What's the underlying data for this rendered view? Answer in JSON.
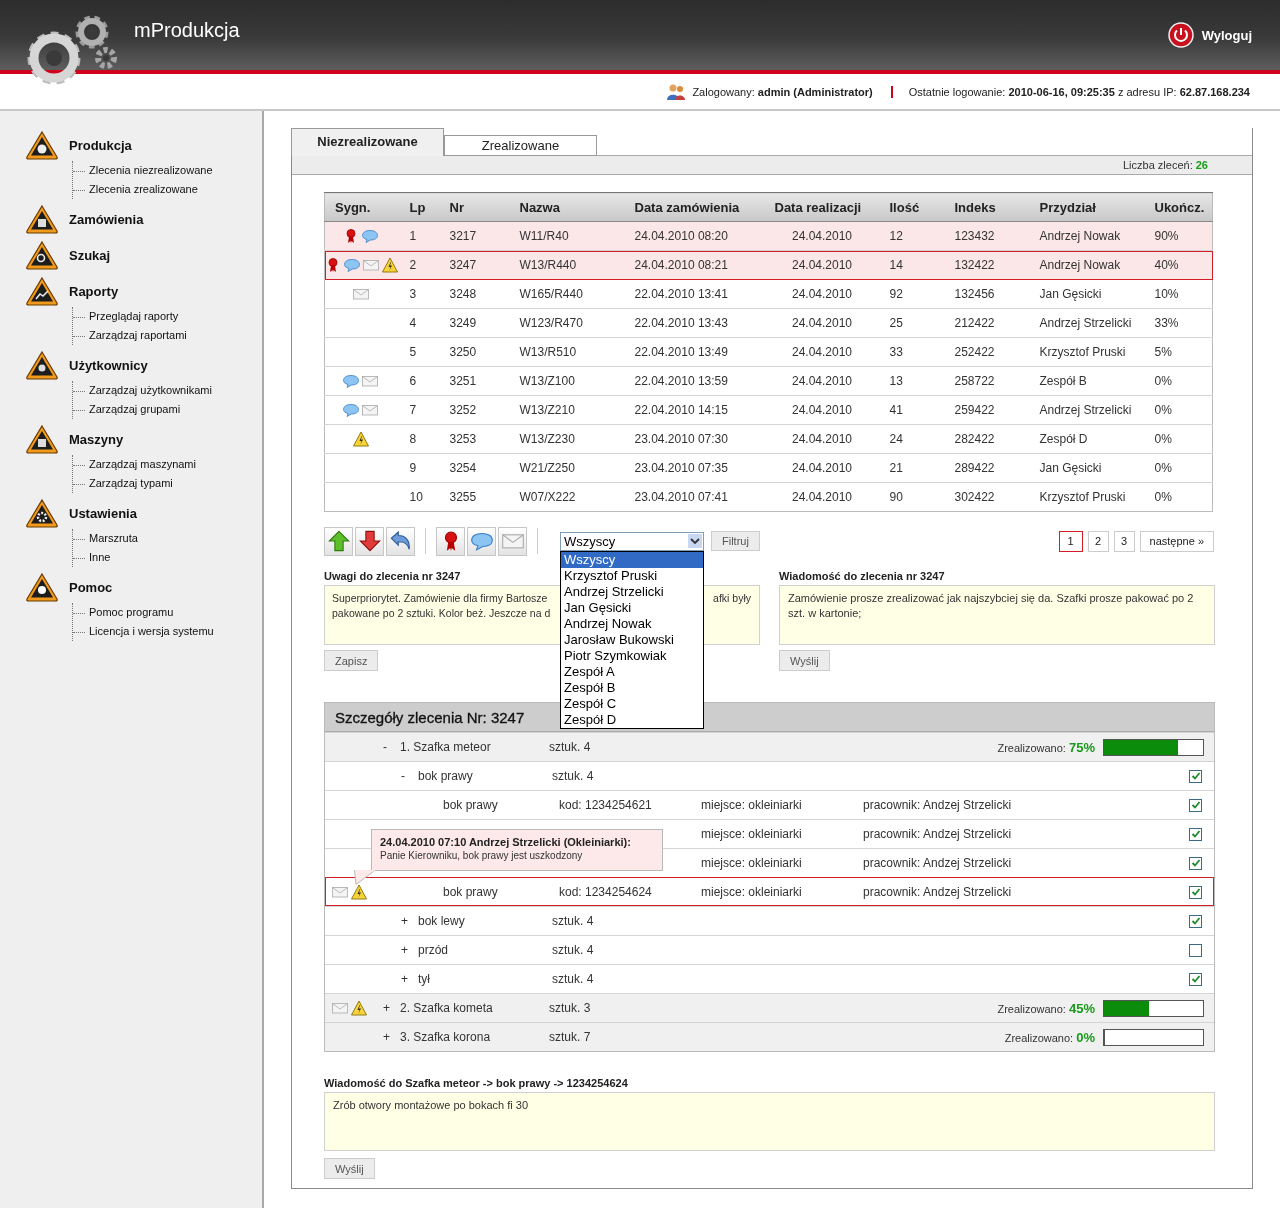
{
  "header": {
    "app_title": "mProdukcja",
    "logout": "Wyloguj"
  },
  "session": {
    "user_label": "Zalogowany:",
    "user": "admin (Administrator)",
    "last_login_label": "Ostatnie logowanie:",
    "last_login": "2010-06-16, 09:25:35",
    "ip_label": "z adresu IP:",
    "ip": "62.87.168.234"
  },
  "sidebar": {
    "items": [
      {
        "label": "Produkcja",
        "children": [
          {
            "label": "Zlecenia niezrealizowane"
          },
          {
            "label": "Zlecenia zrealizowane"
          }
        ]
      },
      {
        "label": "Zamówienia"
      },
      {
        "label": "Szukaj"
      },
      {
        "label": "Raporty",
        "children": [
          {
            "label": "Przeglądaj raporty"
          },
          {
            "label": "Zarządzaj raportami"
          }
        ]
      },
      {
        "label": "Użytkownicy",
        "children": [
          {
            "label": "Zarządzaj użytkownikami"
          },
          {
            "label": "Zarządzaj grupami"
          }
        ]
      },
      {
        "label": "Maszyny",
        "children": [
          {
            "label": "Zarządzaj maszynami"
          },
          {
            "label": "Zarządzaj typami"
          }
        ]
      },
      {
        "label": "Ustawienia",
        "children": [
          {
            "label": "Marszruta"
          },
          {
            "label": "Inne"
          }
        ]
      },
      {
        "label": "Pomoc",
        "children": [
          {
            "label": "Pomoc programu"
          },
          {
            "label": "Licencja i wersja systemu"
          }
        ]
      }
    ]
  },
  "tabs": [
    {
      "label": "Niezrealizowane",
      "selected": true
    },
    {
      "label": "Zrealizowane",
      "selected": false
    }
  ],
  "order_count": {
    "label": "Liczba zleceń:",
    "value": "26"
  },
  "table": {
    "columns": [
      "Sygn.",
      "Lp",
      "Nr",
      "Nazwa",
      "Data zamówienia",
      "Data realizacji",
      "Ilość",
      "Indeks",
      "Przydział",
      "Ukończ."
    ],
    "rows": [
      {
        "priority": true,
        "comment": true,
        "message": false,
        "alert": false,
        "cells": [
          "",
          "1",
          "3217",
          "W11/R40",
          "24.04.2010 08:20",
          "24.04.2010",
          "12",
          "123432",
          "Andrzej Nowak",
          "90%"
        ],
        "flagged": true,
        "selected": false
      },
      {
        "priority": true,
        "comment": true,
        "message": true,
        "alert": true,
        "cells": [
          "",
          "2",
          "3247",
          "W13/R440",
          "24.04.2010 08:21",
          "24.04.2010",
          "14",
          "132422",
          "Andrzej Nowak",
          "40%"
        ],
        "flagged": true,
        "selected": true
      },
      {
        "priority": false,
        "comment": false,
        "message": true,
        "alert": false,
        "cells": [
          "",
          "3",
          "3248",
          "W165/R440",
          "22.04.2010 13:41",
          "24.04.2010",
          "92",
          "132456",
          "Jan Gęsicki",
          "10%"
        ],
        "flagged": false,
        "selected": false
      },
      {
        "priority": false,
        "comment": false,
        "message": false,
        "alert": false,
        "cells": [
          "",
          "4",
          "3249",
          "W123/R470",
          "22.04.2010 13:43",
          "24.04.2010",
          "25",
          "212422",
          "Andrzej Strzelicki",
          "33%"
        ],
        "flagged": false,
        "selected": false
      },
      {
        "priority": false,
        "comment": false,
        "message": false,
        "alert": false,
        "cells": [
          "",
          "5",
          "3250",
          "W13/R510",
          "22.04.2010 13:49",
          "24.04.2010",
          "33",
          "252422",
          "Krzysztof Pruski",
          "5%"
        ],
        "flagged": false,
        "selected": false
      },
      {
        "priority": false,
        "comment": true,
        "message": true,
        "alert": false,
        "cells": [
          "",
          "6",
          "3251",
          "W13/Z100",
          "22.04.2010 13:59",
          "24.04.2010",
          "13",
          "258722",
          "Zespół B",
          "0%"
        ],
        "flagged": false,
        "selected": false
      },
      {
        "priority": false,
        "comment": true,
        "message": true,
        "alert": false,
        "cells": [
          "",
          "7",
          "3252",
          "W13/Z210",
          "22.04.2010 14:15",
          "24.04.2010",
          "41",
          "259422",
          "Andrzej Strzelicki",
          "0%"
        ],
        "flagged": false,
        "selected": false
      },
      {
        "priority": false,
        "comment": false,
        "message": false,
        "alert": true,
        "cells": [
          "",
          "8",
          "3253",
          "W13/Z230",
          "23.04.2010 07:30",
          "24.04.2010",
          "24",
          "282422",
          "Zespół D",
          "0%"
        ],
        "flagged": false,
        "selected": false
      },
      {
        "priority": false,
        "comment": false,
        "message": false,
        "alert": false,
        "cells": [
          "",
          "9",
          "3254",
          "W21/Z250",
          "23.04.2010 07:35",
          "24.04.2010",
          "21",
          "289422",
          "Jan Gęsicki",
          "0%"
        ],
        "flagged": false,
        "selected": false
      },
      {
        "priority": false,
        "comment": false,
        "message": false,
        "alert": false,
        "cells": [
          "",
          "10",
          "3255",
          "W07/X222",
          "23.04.2010 07:41",
          "24.04.2010",
          "90",
          "302422",
          "Krzysztof Pruski",
          "0%"
        ],
        "flagged": false,
        "selected": false
      }
    ]
  },
  "filter": {
    "value": "Wszyscy",
    "button": "Filtruj",
    "expanded": true,
    "options": [
      {
        "label": "Wszyscy",
        "selected": true
      },
      {
        "label": "Krzysztof Pruski",
        "selected": false
      },
      {
        "label": "Andrzej Strzelicki",
        "selected": false
      },
      {
        "label": "Jan Gęsicki",
        "selected": false
      },
      {
        "label": "Andrzej Nowak",
        "selected": false
      },
      {
        "label": "Jarosław Bukowski",
        "selected": false
      },
      {
        "label": "Piotr Szymkowiak",
        "selected": false
      },
      {
        "label": "Zespół A",
        "selected": false
      },
      {
        "label": "Zespół B",
        "selected": false
      },
      {
        "label": "Zespół C",
        "selected": false
      },
      {
        "label": "Zespół D",
        "selected": false
      }
    ]
  },
  "pagination": {
    "pages": [
      {
        "label": "1",
        "selected": true
      },
      {
        "label": "2",
        "selected": false
      },
      {
        "label": "3",
        "selected": false
      }
    ],
    "next": "następne »"
  },
  "notes": {
    "title": "Uwagi do zlecenia nr 3247",
    "fragments": [
      "Superpriorytet. Zamówienie dla firmy Bartosze",
      "afki były",
      "pakowane po 2 sztuki. Kolor beż. Jeszcze na d"
    ],
    "button": "Zapisz"
  },
  "message": {
    "title": "Wiadomość do zlecenia nr 3247",
    "text": "Zamówienie prosze zrealizować jak najszybciej się da. Szafki prosze pakować po 2 szt. w kartonie;",
    "button": "Wyślij"
  },
  "details": {
    "title": "Szczegóły zlecenia Nr:",
    "number": "3247",
    "rows": [
      {
        "kind": "group",
        "message": false,
        "alert": false,
        "toggle": "-",
        "name": "1. Szafka meteor",
        "qty": "sztuk. 4",
        "done_label": "Zrealizowano:",
        "done": "75%",
        "level": 0.75,
        "selected": false
      },
      {
        "kind": "part",
        "message": false,
        "alert": false,
        "toggle": "-",
        "name": "bok prawy",
        "qty": "sztuk. 4",
        "checked": true,
        "selected": false
      },
      {
        "kind": "item",
        "message": false,
        "alert": false,
        "name": "bok prawy",
        "code": "kod: 1234254621",
        "place": "miejsce: okleiniarki",
        "worker": "pracownik: Andzej Strzelicki",
        "checked": true,
        "selected": false
      },
      {
        "kind": "item",
        "message": false,
        "alert": false,
        "place": "miejsce: okleiniarki",
        "worker": "pracownik: Andzej Strzelicki",
        "checked": true,
        "selected": false
      },
      {
        "kind": "item",
        "message": false,
        "alert": false,
        "place": "miejsce: okleiniarki",
        "worker": "pracownik: Andzej Strzelicki",
        "checked": true,
        "selected": false
      },
      {
        "kind": "item",
        "message": true,
        "alert": true,
        "name": "bok prawy",
        "code": "kod: 1234254624",
        "place": "miejsce: okleiniarki",
        "worker": "pracownik: Andzej Strzelicki",
        "checked": true,
        "selected": true
      },
      {
        "kind": "part",
        "message": false,
        "alert": false,
        "toggle": "+",
        "name": "bok lewy",
        "qty": "sztuk. 4",
        "checked": true,
        "selected": false
      },
      {
        "kind": "part",
        "message": false,
        "alert": false,
        "toggle": "+",
        "name": "przód",
        "qty": "sztuk. 4",
        "checked": false,
        "selected": false
      },
      {
        "kind": "part",
        "message": false,
        "alert": false,
        "toggle": "+",
        "name": "tył",
        "qty": "sztuk. 4",
        "checked": true,
        "selected": false
      },
      {
        "kind": "group",
        "message": true,
        "alert": true,
        "toggle": "+",
        "name": "2. Szafka kometa",
        "qty": "sztuk. 3",
        "done_label": "Zrealizowano:",
        "done": "45%",
        "level": 0.45,
        "selected": false
      },
      {
        "kind": "group",
        "message": false,
        "alert": false,
        "toggle": "+",
        "name": "3. Szafka korona",
        "qty": "sztuk. 7",
        "done_label": "Zrealizowano:",
        "done": "0%",
        "level": 0,
        "selected": false
      }
    ],
    "tooltip": {
      "title": "24.04.2010 07:10 Andrzej Strzelicki (Okleiniarki):",
      "text": "Panie Kierowniku, bok prawy jest uszkodzony"
    }
  },
  "item_message": {
    "title": "Wiadomość do Szafka meteor -> bok prawy -> 1234254624",
    "text": "Zrób otwory montażowe po bokach fi 30",
    "button": "Wyślij"
  }
}
